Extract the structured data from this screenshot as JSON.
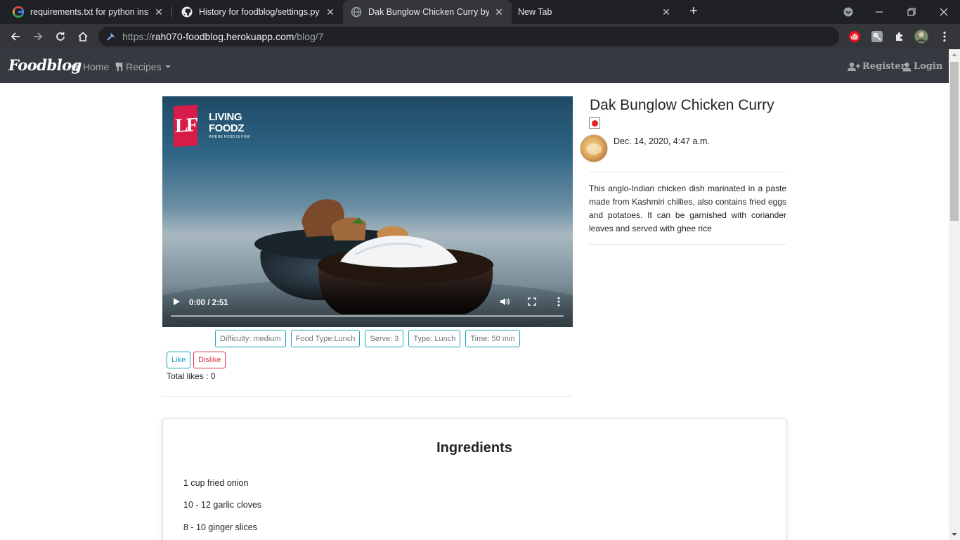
{
  "browser": {
    "tabs": [
      {
        "title": "requirements.txt for python insta",
        "favicon": "google-icon"
      },
      {
        "title": "History for foodblog/settings.py",
        "favicon": "github-icon"
      },
      {
        "title": "Dak Bunglow Chicken Curry by ra",
        "favicon": "globe-icon",
        "active": true
      },
      {
        "title": "New Tab",
        "favicon": ""
      }
    ],
    "url_scheme": "https://",
    "url_host": "rah070-foodblog.herokuapp.com",
    "url_path": "/blog/7"
  },
  "navbar": {
    "brand": "Foodblog",
    "home": "Home",
    "recipes": "Recipes",
    "register": "Register",
    "login": "Login"
  },
  "video": {
    "logo_mark": "LF",
    "logo_line1": "LIVING",
    "logo_line2": "FOODZ",
    "logo_tagline": "WHERE FOOD IS FUN!",
    "time": "0:00 / 2:51",
    "progress": 0
  },
  "recipe": {
    "badges": [
      "Difficulty: medium",
      "Food Type:Lunch",
      "Serve: 3",
      "Type: Lunch",
      "Time: 50 min"
    ],
    "like_label": "Like",
    "dislike_label": "Dislike",
    "total_likes": "Total likes : 0"
  },
  "post": {
    "title": "Dak Bunglow Chicken Curry",
    "date": "Dec. 14, 2020, 4:47 a.m.",
    "description": "This anglo-Indian chicken dish marinated in a paste made from Kashmiri chillies, also contains fried eggs and potatoes. It can be garnished with coriander leaves and served with ghee rice"
  },
  "ingredients": {
    "title": "Ingredients",
    "items": [
      "1 cup fried onion",
      "10 - 12 garlic cloves",
      "8 - 10 ginger slices"
    ]
  },
  "colors": {
    "navbar_bg": "#343a40",
    "info": "#17a2b8",
    "danger": "#dc3545"
  }
}
